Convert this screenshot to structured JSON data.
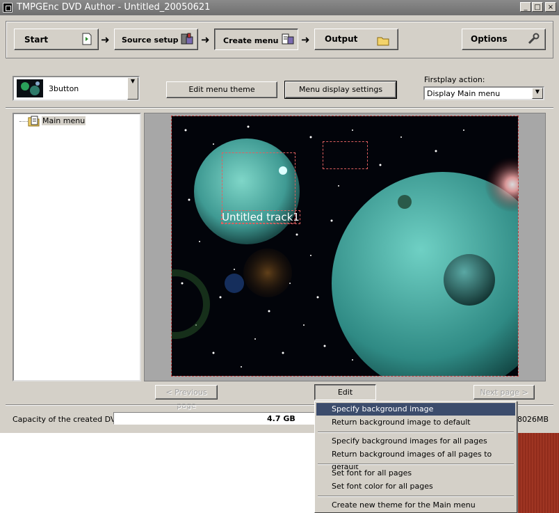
{
  "window": {
    "title": "TMPGEnc DVD Author - Untitled_20050621"
  },
  "steps": [
    {
      "label": "Start",
      "icon": "document-arrow-icon"
    },
    {
      "label": "Source setup",
      "icon": "film-box-icon"
    },
    {
      "label": "Create menu",
      "icon": "menu-box-icon"
    },
    {
      "label": "Output",
      "icon": "folder-icon"
    }
  ],
  "options_label": "Options",
  "theme_select": {
    "value": "3button"
  },
  "edit_theme_label": "Edit menu theme",
  "display_settings_label": "Menu display settings",
  "firstplay": {
    "label": "Firstplay action:",
    "value": "Display Main menu"
  },
  "tree": {
    "items": [
      {
        "label": "Main menu"
      }
    ]
  },
  "canvas": {
    "track_label": "Untitled track1"
  },
  "nav": {
    "previous": "< Previous page",
    "edit": "Edit",
    "next": "Next page >"
  },
  "capacity": {
    "label": "Capacity of the created DVD:",
    "value": "4.7 GB",
    "used_text": "8026MB"
  },
  "context_menu": {
    "items": [
      {
        "label": "Specify background image",
        "selected": true
      },
      {
        "label": "Return background image to default"
      },
      {
        "label": "Specify background images for all pages"
      },
      {
        "label": "Return background images of all pages to default"
      },
      {
        "label": "Set font for all pages"
      },
      {
        "label": "Set font color for all pages"
      },
      {
        "label": "Create new theme for the Main menu"
      }
    ]
  },
  "colors": {
    "selection": "#3c4c6c",
    "face": "#d4d0c8",
    "title_bar": "#7a7a7a"
  }
}
